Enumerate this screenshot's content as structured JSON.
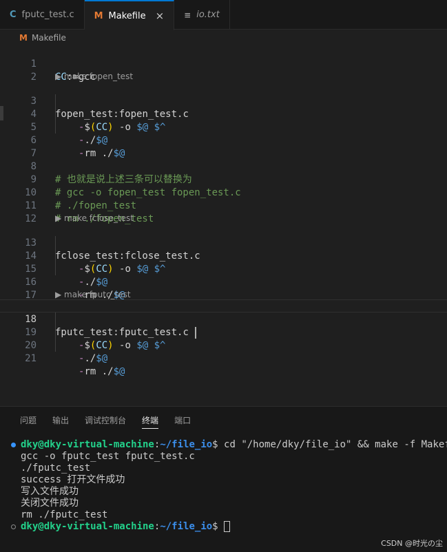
{
  "tabs": [
    {
      "icon": "C",
      "label": "fputc_test.c"
    },
    {
      "icon": "M",
      "label": "Makefile",
      "close": "×"
    },
    {
      "icon": "≡",
      "label": "io.txt"
    }
  ],
  "breadcrumb": {
    "icon": "M",
    "label": "Makefile"
  },
  "editor": {
    "lines": {
      "l1": {
        "n": "1",
        "a": "CC",
        "b": ":=gcc"
      },
      "l2": {
        "n": "2"
      },
      "lens1": "▶ make fopen_test",
      "l3": {
        "n": "3",
        "a": "fopen_test",
        "b": ":fopen_test.c"
      },
      "l4": {
        "n": "4",
        "dash": "-",
        "d": "$",
        "p1": "(",
        "cc": "CC",
        "p2": ")",
        "rest": " -o ",
        "at": "$@",
        "sp": " ",
        "caret": "$^"
      },
      "l5": {
        "n": "5",
        "dash": "-",
        "pre": "./",
        "at": "$@"
      },
      "l6": {
        "n": "6",
        "dash": "-",
        "pre": "rm ./",
        "at": "$@"
      },
      "l7": {
        "n": "7"
      },
      "l8": {
        "n": "8",
        "text": "# 也就是说上述三条可以替换为"
      },
      "l9": {
        "n": "9",
        "text": "# gcc -o fopen_test fopen_test.c"
      },
      "l10": {
        "n": "10",
        "text": "# ./fopen_test"
      },
      "l11": {
        "n": "11",
        "text": "# rm ./fopen_test"
      },
      "l12": {
        "n": "12"
      },
      "lens2": "▶ make fclose_test",
      "l13": {
        "n": "13",
        "a": "fclose_test",
        "b": ":fclose_test.c"
      },
      "l14": {
        "n": "14",
        "dash": "-",
        "d": "$",
        "p1": "(",
        "cc": "CC",
        "p2": ")",
        "rest": " -o ",
        "at": "$@",
        "sp": " ",
        "caret": "$^"
      },
      "l15": {
        "n": "15",
        "dash": "-",
        "pre": "./",
        "at": "$@"
      },
      "l16": {
        "n": "16",
        "dash": "-",
        "pre": "rm ./",
        "at": "$@"
      },
      "l17": {
        "n": "17"
      },
      "lens3": "▶ make fputc_test",
      "l18": {
        "n": "18",
        "a": "fputc_test",
        "b": ":fputc_test.c "
      },
      "l19": {
        "n": "19",
        "dash": "-",
        "d": "$",
        "p1": "(",
        "cc": "CC",
        "p2": ")",
        "rest": " -o ",
        "at": "$@",
        "sp": " ",
        "caret": "$^"
      },
      "l20": {
        "n": "20",
        "dash": "-",
        "pre": "./",
        "at": "$@"
      },
      "l21": {
        "n": "21",
        "dash": "-",
        "pre": "rm ./",
        "at": "$@"
      }
    }
  },
  "panel": {
    "tabs": [
      "问题",
      "输出",
      "调试控制台",
      "终端",
      "端口"
    ],
    "terminal": {
      "prompt_user": "dky@dky-virtual-machine",
      "prompt_colon": ":",
      "prompt_path": "~/file_io",
      "prompt_dollar": "$ ",
      "command": "cd \"/home/dky/file_io\" && make -f Makefile",
      "output": [
        "gcc -o fputc_test fputc_test.c",
        "./fputc_test",
        "success 打开文件成功",
        "写入文件成功",
        "关闭文件成功",
        "rm ./fputc_test"
      ]
    }
  },
  "watermark": "CSDN @时光の尘",
  "colors": {
    "accent": "#0078d4",
    "prompt_user": "#23d18b",
    "prompt_path": "#3b8eea",
    "comment": "#6a9955"
  }
}
